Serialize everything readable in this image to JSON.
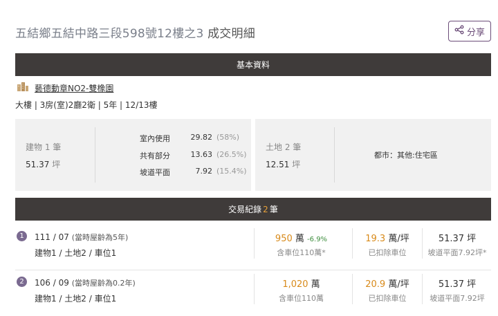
{
  "header": {
    "address": "五結鄉五結中路三段598號12樓之3",
    "suffix": "成交明細",
    "share_label": "分享"
  },
  "basic": {
    "band_title": "基本資料",
    "community_name": "藝德動章NO2-雙橡園",
    "specs": "大樓 | 3房(室)2廳2衛 | 5年 | 12/13樓",
    "building": {
      "label": "建物 1 筆",
      "value": "51.37",
      "unit": "坪",
      "parts": [
        {
          "name": "室內使用",
          "value": "29.82",
          "pct": "(58%)"
        },
        {
          "name": "共有部分",
          "value": "13.63",
          "pct": "(26.5%)"
        },
        {
          "name": "坡道平面",
          "value": "7.92",
          "pct": "(15.4%)"
        }
      ]
    },
    "land": {
      "label": "土地 2 筆",
      "value": "12.51",
      "unit": "坪",
      "zoning": "都市：其他:住宅區"
    }
  },
  "transactions": {
    "band_prefix": "交易紀錄",
    "count": "2",
    "band_suffix": "筆",
    "rows": [
      {
        "index": "1",
        "date": "111 / 07",
        "age": "(當時屋齡為5年)",
        "assets": "建物1 / 土地2 / 車位1",
        "price": "950",
        "price_unit": "萬",
        "change": "-6.9%",
        "price_note": "含車位110萬*",
        "unit_price": "19.3",
        "unit_price_unit": "萬/坪",
        "unit_price_note": "已扣除車位",
        "area": "51.37 坪",
        "area_note": "坡道平面7.92坪*"
      },
      {
        "index": "2",
        "date": "106 / 09",
        "age": "(當時屋齡為0.2年)",
        "assets": "建物1 / 土地2 / 車位1",
        "price": "1,020",
        "price_unit": "萬",
        "change": "",
        "price_note": "含車位110萬",
        "unit_price": "20.9",
        "unit_price_unit": "萬/坪",
        "unit_price_note": "已扣除車位",
        "area": "51.37 坪",
        "area_note": "坡道平面7.92坪"
      }
    ]
  },
  "colors": {
    "accent": "#6b4c78",
    "orange": "#d88a1a",
    "band": "#3f3b3a",
    "panel": "#f1f1f1"
  },
  "icons": {
    "share": "share-icon",
    "community": "building-icon"
  }
}
